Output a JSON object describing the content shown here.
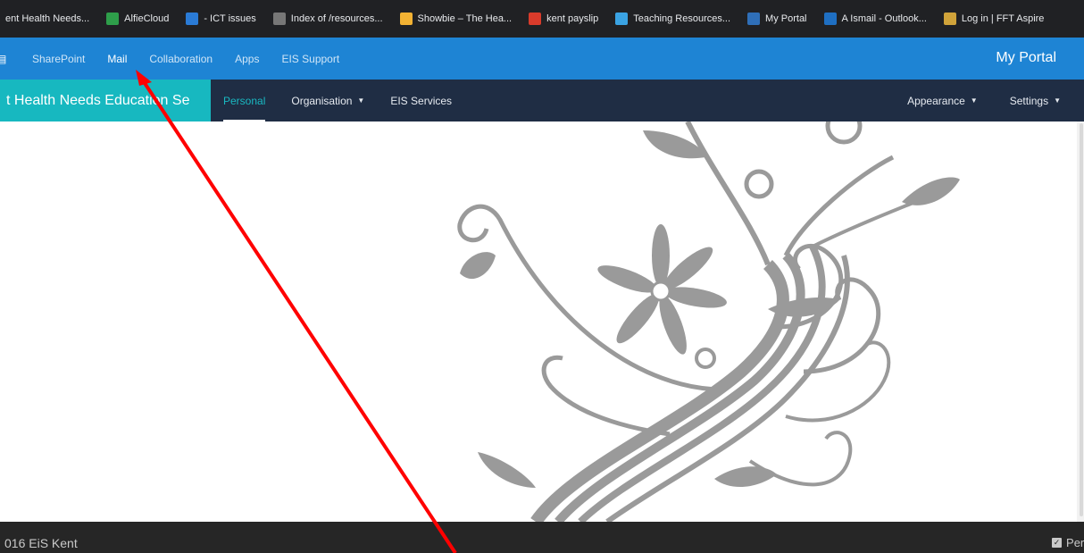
{
  "bookmarks": [
    {
      "label": "ent Health Needs...",
      "icon": "none",
      "color": ""
    },
    {
      "label": "AlfieCloud",
      "icon": "alfiecloud-icon",
      "color": "#2e9e4a"
    },
    {
      "label": "- ICT issues",
      "icon": "ict-issues-icon",
      "color": "#2a7bd6"
    },
    {
      "label": "Index of /resources...",
      "icon": "index-page-icon",
      "color": "#777777"
    },
    {
      "label": "Showbie – The Hea...",
      "icon": "showbie-icon",
      "color": "#f2b233"
    },
    {
      "label": "kent payslip",
      "icon": "payslip-icon",
      "color": "#d93b2b"
    },
    {
      "label": "Teaching Resources...",
      "icon": "teaching-resources-icon",
      "color": "#3aa3e3"
    },
    {
      "label": "My Portal",
      "icon": "my-portal-icon",
      "color": "#2f6fb8"
    },
    {
      "label": "A Ismail - Outlook...",
      "icon": "outlook-icon",
      "color": "#1f6fc2"
    },
    {
      "label": "Log in | FFT Aspire",
      "icon": "fft-aspire-icon",
      "color": "#d0a33a"
    }
  ],
  "suitebar": {
    "links": [
      {
        "label": "SharePoint",
        "active": false
      },
      {
        "label": "Mail",
        "active": true
      },
      {
        "label": "Collaboration",
        "active": false
      },
      {
        "label": "Apps",
        "active": false
      },
      {
        "label": "EIS Support",
        "active": false
      }
    ],
    "brand": "My Portal"
  },
  "navbar": {
    "site_title": "t Health Needs Education Se",
    "left_links": [
      {
        "label": "Personal",
        "dropdown": false,
        "active": true
      },
      {
        "label": "Organisation",
        "dropdown": true,
        "active": false
      },
      {
        "label": "EIS Services",
        "dropdown": false,
        "active": false
      }
    ],
    "right_links": [
      {
        "label": "Appearance",
        "dropdown": true
      },
      {
        "label": "Settings",
        "dropdown": true
      }
    ]
  },
  "footer": {
    "left_text": "016 EiS Kent",
    "right_text": "Perso"
  },
  "colors": {
    "bookmarks_bg": "#202124",
    "suite_blue": "#1e84d4",
    "navbar_dark": "#1f2d44",
    "site_title_teal": "#17b8c0",
    "decoration_grey": "#9a9a9a",
    "annotation_red": "#ff0000"
  }
}
